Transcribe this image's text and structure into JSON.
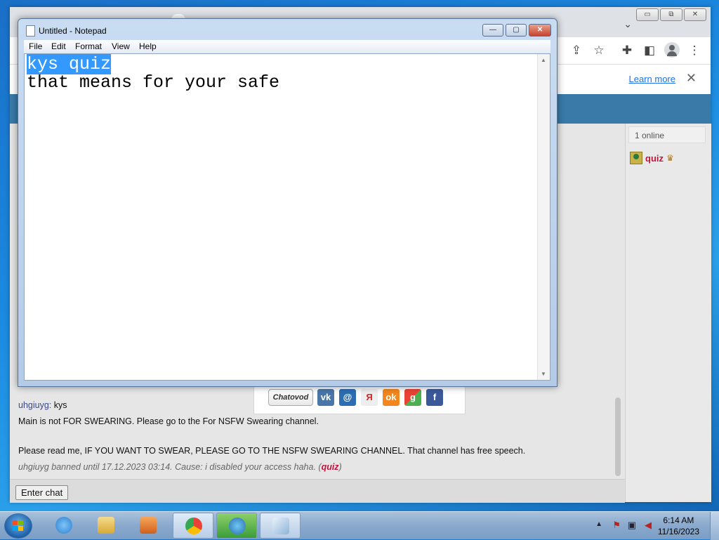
{
  "browser": {
    "learn_more": "Learn more",
    "close_infobar": "✕",
    "window_buttons": [
      "▭",
      "⧉",
      "✕"
    ],
    "tab_dropdown": "⌄",
    "toolbar_icons": [
      "share-icon",
      "star-icon",
      "extensions-icon",
      "sidepanel-icon",
      "profile-icon",
      "menu-icon"
    ]
  },
  "chat": {
    "messages": [
      {
        "nick": "uhgiuyg:",
        "text": " kys"
      },
      {
        "text": "Main is not FOR SWEARING. Please go to the For NSFW Swearing channel."
      },
      {
        "text": "Please read me, IF YOU WANT TO SWEAR, PLEASE GO TO THE NSFW SWEARING CHANNEL. That channel has free speech."
      }
    ],
    "system_message": {
      "text": "uhgiuyg banned until 17.12.2023 03:14. Cause: i disabled your access haha. (",
      "by": "quiz",
      "close": ")"
    },
    "enter_button": "Enter chat",
    "online_count": "1 online",
    "users": [
      {
        "name": "quiz"
      }
    ],
    "share": {
      "logo": "Chatovod",
      "networks": [
        {
          "name": "vk",
          "glyph": "vk",
          "color": "#4a76a8"
        },
        {
          "name": "mail",
          "glyph": "@",
          "color": "#2d6db2"
        },
        {
          "name": "yandex",
          "glyph": "Я",
          "color": "#e8e8e8"
        },
        {
          "name": "odnoklassniki",
          "glyph": "ok",
          "color": "#f2861f"
        },
        {
          "name": "google",
          "glyph": "g",
          "color": "#4caf50"
        },
        {
          "name": "facebook",
          "glyph": "f",
          "color": "#3b5998"
        }
      ]
    }
  },
  "notepad": {
    "title": "Untitled - Notepad",
    "menu": [
      "File",
      "Edit",
      "Format",
      "View",
      "Help"
    ],
    "text_line1_selected": "kys quiz",
    "text_line2": "that means for your safe",
    "buttons": {
      "minimize": "—",
      "maximize": "▢",
      "close": "✕"
    }
  },
  "taskbar": {
    "time": "6:14 AM",
    "date": "11/16/2023",
    "apps": [
      {
        "name": "internet-explorer",
        "color": "#2a7fd4"
      },
      {
        "name": "file-explorer",
        "color": "#e8c25a"
      },
      {
        "name": "media-player",
        "color": "#e07a20"
      },
      {
        "name": "chrome",
        "color": "#34a853"
      },
      {
        "name": "download-manager",
        "color": "#3a9d3a"
      },
      {
        "name": "notepad",
        "color": "#9ec6e8"
      }
    ]
  }
}
